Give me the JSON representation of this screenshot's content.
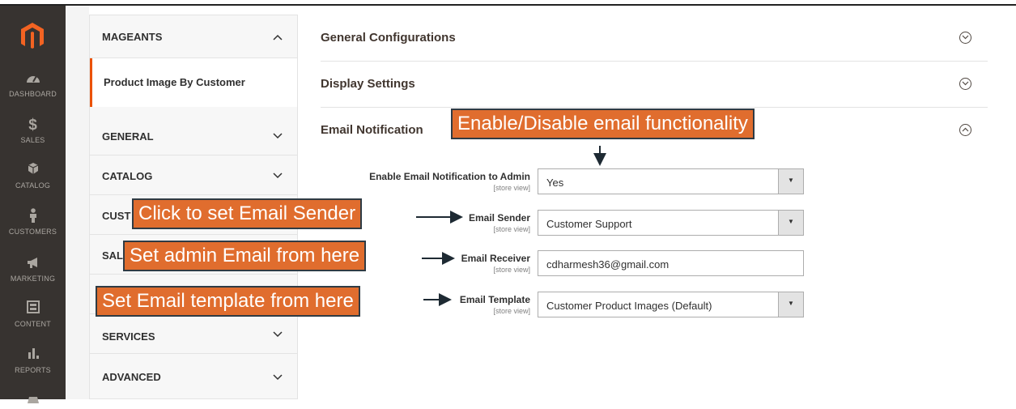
{
  "leftnav": {
    "items": [
      {
        "label": "DASHBOARD",
        "icon": "dashboard-icon"
      },
      {
        "label": "SALES",
        "icon": "dollar-icon"
      },
      {
        "label": "CATALOG",
        "icon": "cube-icon"
      },
      {
        "label": "CUSTOMERS",
        "icon": "person-icon"
      },
      {
        "label": "MARKETING",
        "icon": "megaphone-icon"
      },
      {
        "label": "CONTENT",
        "icon": "layout-icon"
      },
      {
        "label": "REPORTS",
        "icon": "bar-chart-icon"
      }
    ]
  },
  "sidebar": {
    "mageants": "MAGEANTS",
    "product_image": "Product Image By Customer",
    "general": "GENERAL",
    "catalog": "CATALOG",
    "customers_partial": "CUST",
    "sales_partial": "SALE",
    "services": "SERVICES",
    "advanced": "ADVANCED"
  },
  "sections": {
    "general_configurations": "General Configurations",
    "display_settings": "Display Settings",
    "email_notification": "Email Notification"
  },
  "fields": {
    "enable_label": "Enable Email Notification to Admin",
    "enable_scope": "[store view]",
    "enable_value": "Yes",
    "sender_label": "Email Sender",
    "sender_scope": "[store view]",
    "sender_value": "Customer Support",
    "receiver_label": "Email Receiver",
    "receiver_scope": "[store view]",
    "receiver_value": "cdharmesh36@gmail.com",
    "template_label": "Email Template",
    "template_scope": "[store view]",
    "template_value": "Customer Product Images (Default)"
  },
  "callouts": {
    "enable": "Enable/Disable email functionality",
    "sender": "Click to set Email Sender",
    "receiver": "Set admin Email from here",
    "template": "Set Email template from here"
  },
  "colors": {
    "accent": "#eb5202",
    "callout": "#e06d2e",
    "nav": "#373330"
  }
}
